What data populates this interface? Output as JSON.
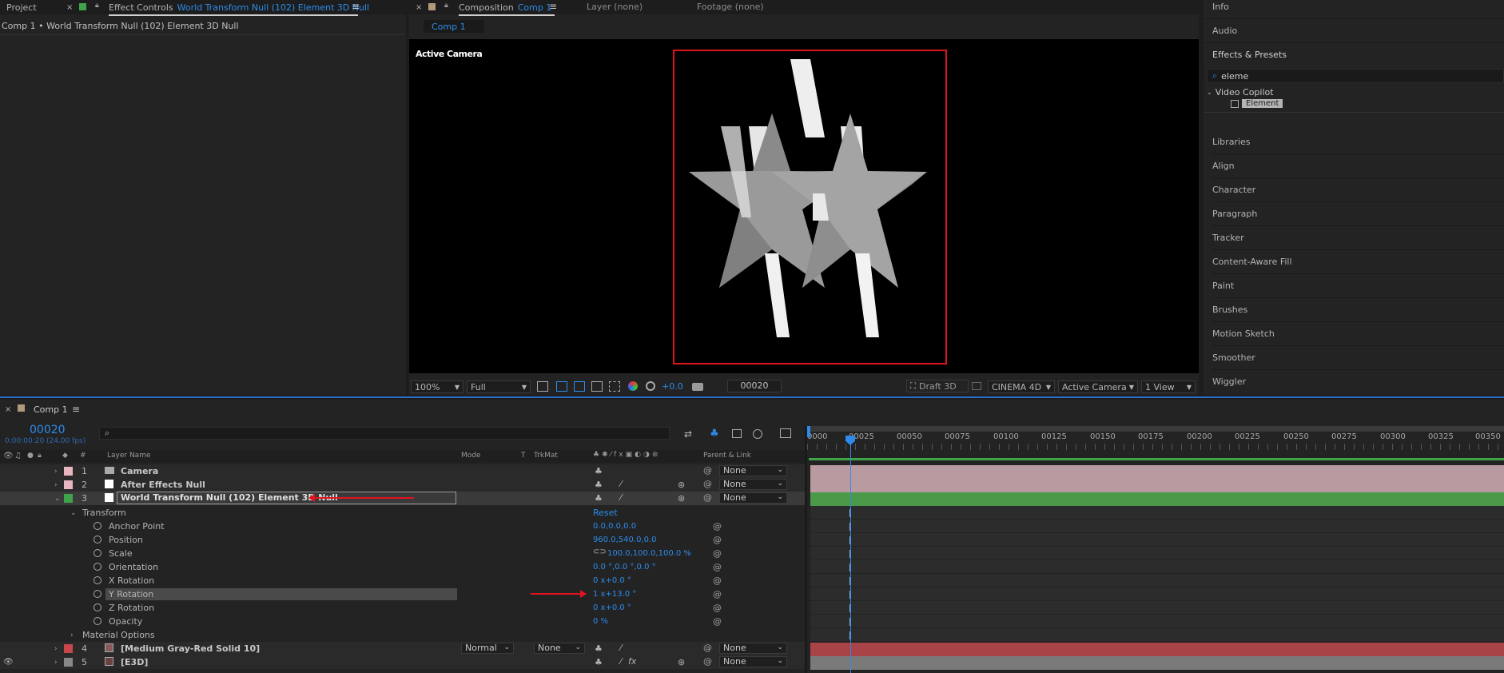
{
  "colors": {
    "accent": "#2d8ceb",
    "panel_bg": "#232323",
    "comp_bg": "#000000",
    "highlight_box": "#e0141e",
    "layer_pink": "#e8b6c0",
    "layer_green": "#3fa34a",
    "layer_red": "#c8474a",
    "layer_gray": "#888888"
  },
  "top_tabs": {
    "project": "Project",
    "effect_controls": "Effect Controls",
    "effect_controls_target": "World Transform Null (102) Element 3D Null",
    "composition": "Composition",
    "composition_target": "Comp 1",
    "layer": "Layer (none)",
    "footage": "Footage (none)"
  },
  "effect_controls": {
    "breadcrumb": "Comp 1 • World Transform Null (102) Element 3D Null"
  },
  "composition": {
    "subtab": "Comp 1",
    "camera_label": "Active Camera",
    "footer": {
      "zoom": "100%",
      "resolution": "Full",
      "exposure": "+0.0",
      "timecode": "00020",
      "draft3d": "Draft 3D",
      "renderer": "CINEMA 4D",
      "view": "Active Camera",
      "layout": "1 View"
    }
  },
  "right_panel": {
    "info": "Info",
    "audio": "Audio",
    "effects_presets": "Effects & Presets",
    "search_value": "eleme",
    "folder": "Video Copilot",
    "effect_item": "Element",
    "items": [
      "Libraries",
      "Align",
      "Character",
      "Paragraph",
      "Tracker",
      "Content-Aware Fill",
      "Paint",
      "Brushes",
      "Motion Sketch",
      "Smoother",
      "Wiggler"
    ]
  },
  "timeline": {
    "tab": "Comp 1",
    "timecode": "00020",
    "timecode_sub": "0:00:00:20 (24.00 fps)",
    "columns": {
      "num": "#",
      "layer_name": "Layer Name",
      "mode": "Mode",
      "t": "T",
      "trkmat": "TrkMat",
      "parent": "Parent & Link"
    },
    "ruler": [
      "0000",
      "00025",
      "00050",
      "00075",
      "00100",
      "00125",
      "00150",
      "00175",
      "00200",
      "00225",
      "00250",
      "00275",
      "00300",
      "00325",
      "00350"
    ],
    "layers": [
      {
        "num": "1",
        "name": "Camera",
        "parent": "None"
      },
      {
        "num": "2",
        "name": "After Effects Null",
        "parent": "None"
      },
      {
        "num": "3",
        "name": "World Transform Null (102) Element 3D Null",
        "parent": "None"
      },
      {
        "num": "4",
        "name": "[Medium Gray-Red Solid 10]",
        "mode": "Normal",
        "trkmat": "None",
        "parent": "None"
      },
      {
        "num": "5",
        "name": "[E3D]",
        "parent": "None"
      }
    ],
    "transform": {
      "label": "Transform",
      "reset": "Reset",
      "props": [
        {
          "name": "Anchor Point",
          "value": "0.0,0.0,0.0"
        },
        {
          "name": "Position",
          "value": "960.0,540.0,0.0"
        },
        {
          "name": "Scale",
          "value": "100.0,100.0,100.0 %"
        },
        {
          "name": "Orientation",
          "value": "0.0 °,0.0 °,0.0 °"
        },
        {
          "name": "X Rotation",
          "value": "0 x+0.0 °"
        },
        {
          "name": "Y Rotation",
          "value": "1 x+13.0 °"
        },
        {
          "name": "Z Rotation",
          "value": "0 x+0.0 °"
        },
        {
          "name": "Opacity",
          "value": "0 %"
        }
      ]
    },
    "material_options": "Material Options"
  }
}
